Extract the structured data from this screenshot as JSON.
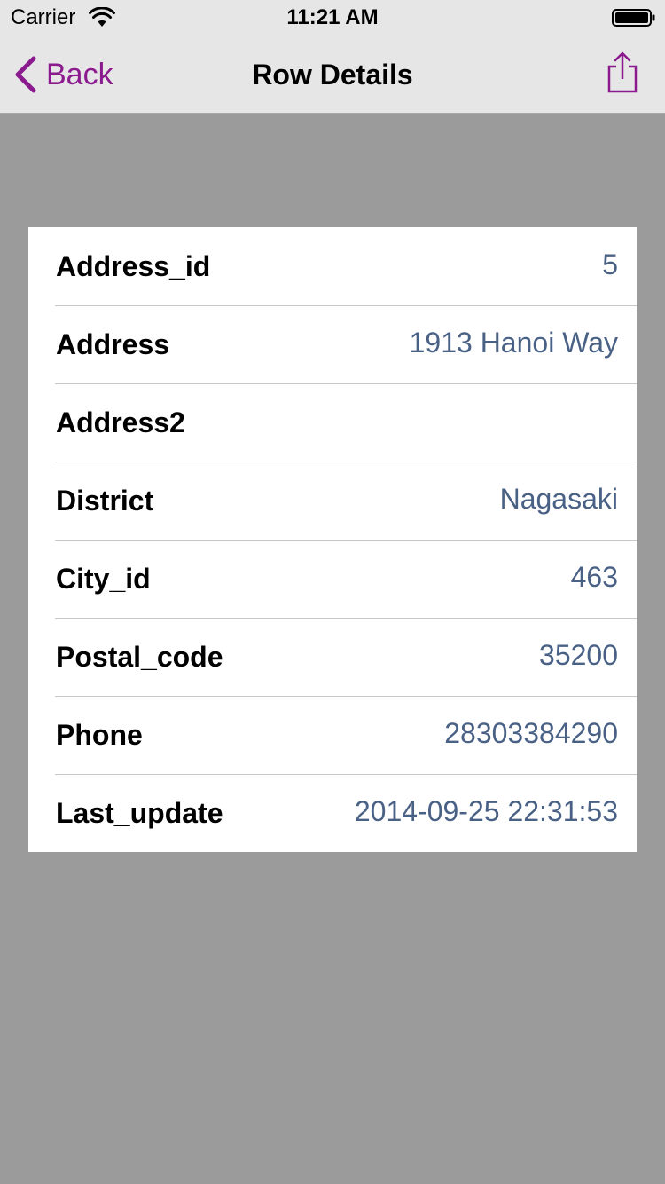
{
  "status_bar": {
    "carrier": "Carrier",
    "time": "11:21 AM"
  },
  "nav": {
    "back_label": "Back",
    "title": "Row Details",
    "accent_color": "#8a1a8e"
  },
  "rows": [
    {
      "label": "Address_id",
      "value": "5"
    },
    {
      "label": "Address",
      "value": "1913 Hanoi Way"
    },
    {
      "label": "Address2",
      "value": ""
    },
    {
      "label": "District",
      "value": "Nagasaki"
    },
    {
      "label": "City_id",
      "value": "463"
    },
    {
      "label": "Postal_code",
      "value": "35200"
    },
    {
      "label": "Phone",
      "value": "28303384290"
    },
    {
      "label": "Last_update",
      "value": "2014-09-25 22:31:53"
    }
  ],
  "colors": {
    "background": "#9b9b9b",
    "value_text": "#4a6186"
  }
}
